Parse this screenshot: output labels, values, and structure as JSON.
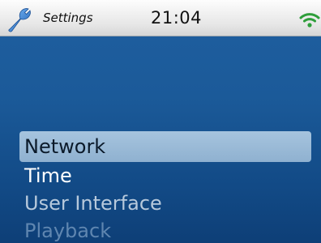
{
  "status_bar": {
    "app_icon": "wrench-icon",
    "title": "Settings",
    "time": "21:04",
    "signal_icon": "wifi-signal-icon"
  },
  "menu": {
    "selected_index": 0,
    "items": [
      {
        "label": "Network",
        "state": "selected"
      },
      {
        "label": "Time",
        "state": "normal"
      },
      {
        "label": "User Interface",
        "state": "dimmed"
      },
      {
        "label": "Playback",
        "state": "faded"
      }
    ]
  },
  "colors": {
    "background": "#1b5a99",
    "status_bar": "#e6e6e6",
    "selection": "#9bbad6",
    "wifi": "#2e9e3a",
    "wrench": "#2f7fd0"
  }
}
